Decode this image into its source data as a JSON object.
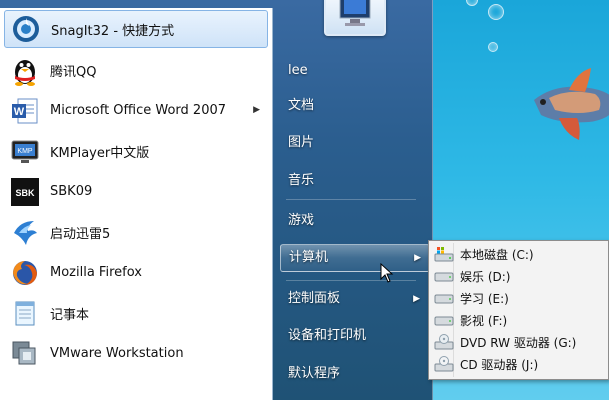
{
  "programs": [
    {
      "label": "SnagIt32 - 快捷方式",
      "icon": "snagit-icon",
      "has_arrow": false
    },
    {
      "label": "腾讯QQ",
      "icon": "qq-penguin-icon",
      "has_arrow": false
    },
    {
      "label": "Microsoft Office Word 2007",
      "icon": "word-icon",
      "has_arrow": true
    },
    {
      "label": "KMPlayer中文版",
      "icon": "kmplayer-icon",
      "has_arrow": false
    },
    {
      "label": "SBK09",
      "icon": "sbk-icon",
      "has_arrow": false
    },
    {
      "label": "启动迅雷5",
      "icon": "thunder-icon",
      "has_arrow": false
    },
    {
      "label": "Mozilla Firefox",
      "icon": "firefox-icon",
      "has_arrow": false
    },
    {
      "label": "记事本",
      "icon": "notepad-icon",
      "has_arrow": false
    },
    {
      "label": "VMware Workstation",
      "icon": "vmware-icon",
      "has_arrow": false
    }
  ],
  "right_menu": {
    "user": "lee",
    "items": [
      {
        "label": "文档"
      },
      {
        "label": "图片"
      },
      {
        "label": "音乐"
      },
      {
        "label": "游戏"
      },
      {
        "label": "计算机"
      },
      {
        "label": "控制面板"
      },
      {
        "label": "设备和打印机"
      },
      {
        "label": "默认程序"
      }
    ]
  },
  "computer_submenu": [
    {
      "label": "本地磁盘 (C:)",
      "icon": "windows-drive-icon"
    },
    {
      "label": "娱乐 (D:)",
      "icon": "hard-drive-icon"
    },
    {
      "label": "学习 (E:)",
      "icon": "hard-drive-icon"
    },
    {
      "label": "影视 (F:)",
      "icon": "hard-drive-icon"
    },
    {
      "label": "DVD RW 驱动器 (G:)",
      "icon": "dvd-drive-icon"
    },
    {
      "label": "CD 驱动器 (J:)",
      "icon": "cd-drive-icon"
    }
  ],
  "colors": {
    "desktop": "#2fb9e6",
    "menu_glass": "#2b5e8f",
    "highlight_border": "#86b4e5"
  }
}
